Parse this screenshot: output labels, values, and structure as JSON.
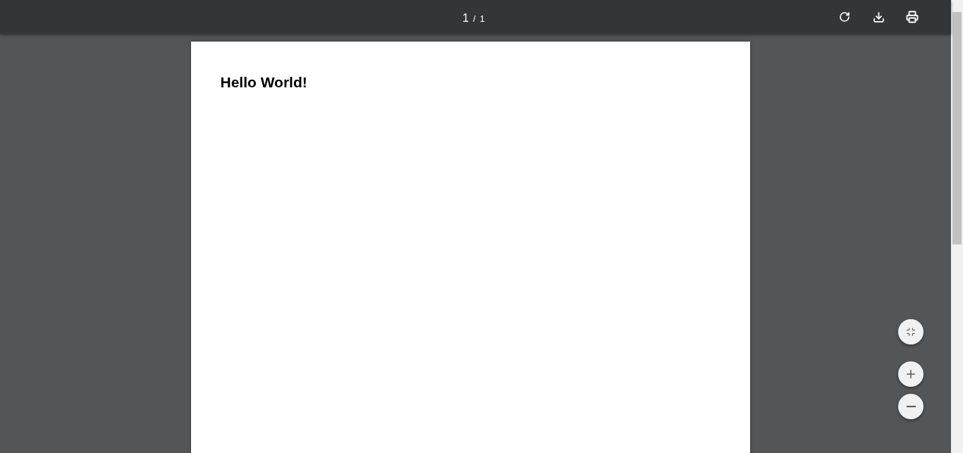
{
  "toolbar": {
    "page_current": "1",
    "page_separator": "/",
    "page_total": "1"
  },
  "document": {
    "heading": "Hello World!"
  }
}
